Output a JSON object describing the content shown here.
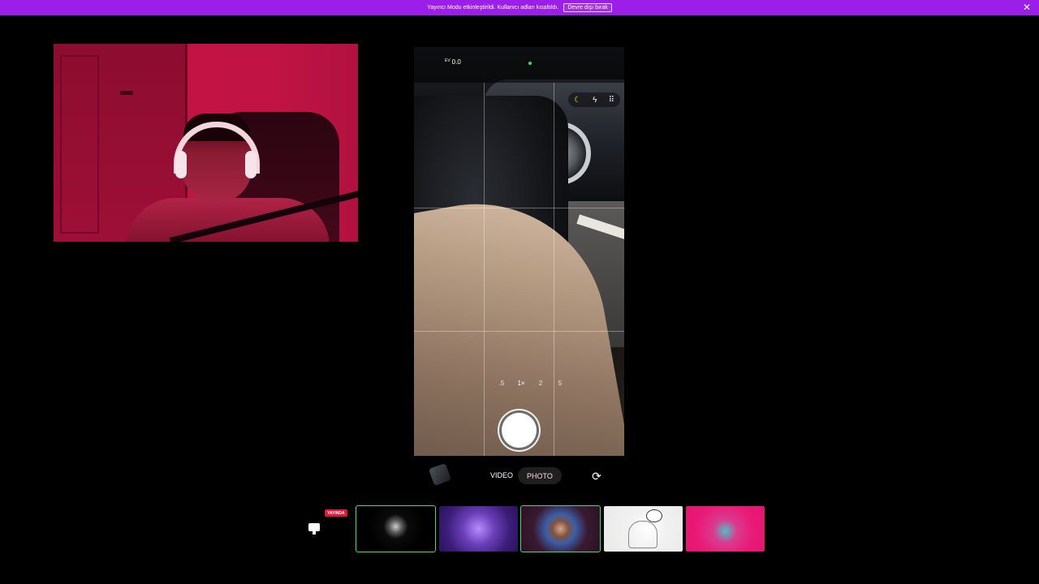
{
  "banner": {
    "message": "Yayıncı Modu etkinleştirildi. Kullanıcı adları kısaltıldı.",
    "disable_label": "Devre dışı bırak",
    "close_glyph": "✕",
    "background": "#9b1fe8"
  },
  "camera": {
    "ev_label": "EV",
    "ev_value": "0.0",
    "quick_icons": [
      "moon-icon",
      "flash-off-icon",
      "grid-menu-icon"
    ],
    "quick_glyphs": {
      "moon": "☾",
      "flash": "ϟ",
      "grid": "⠿"
    },
    "zoom_levels": [
      ".5",
      "1×",
      "2",
      "5"
    ],
    "active_zoom": "1×",
    "modes": {
      "video": "VIDEO",
      "photo": "PHOTO"
    },
    "selected_mode": "PHOTO",
    "flip_glyph": "⟳"
  },
  "stream_strip": {
    "live_badge": "YAYINDA",
    "thumbnails": [
      "thumb-user-1",
      "thumb-user-2",
      "thumb-user-3",
      "thumb-user-4",
      "thumb-user-5"
    ],
    "selected_indices": [
      0,
      2
    ],
    "selection_color": "#35e06a"
  }
}
